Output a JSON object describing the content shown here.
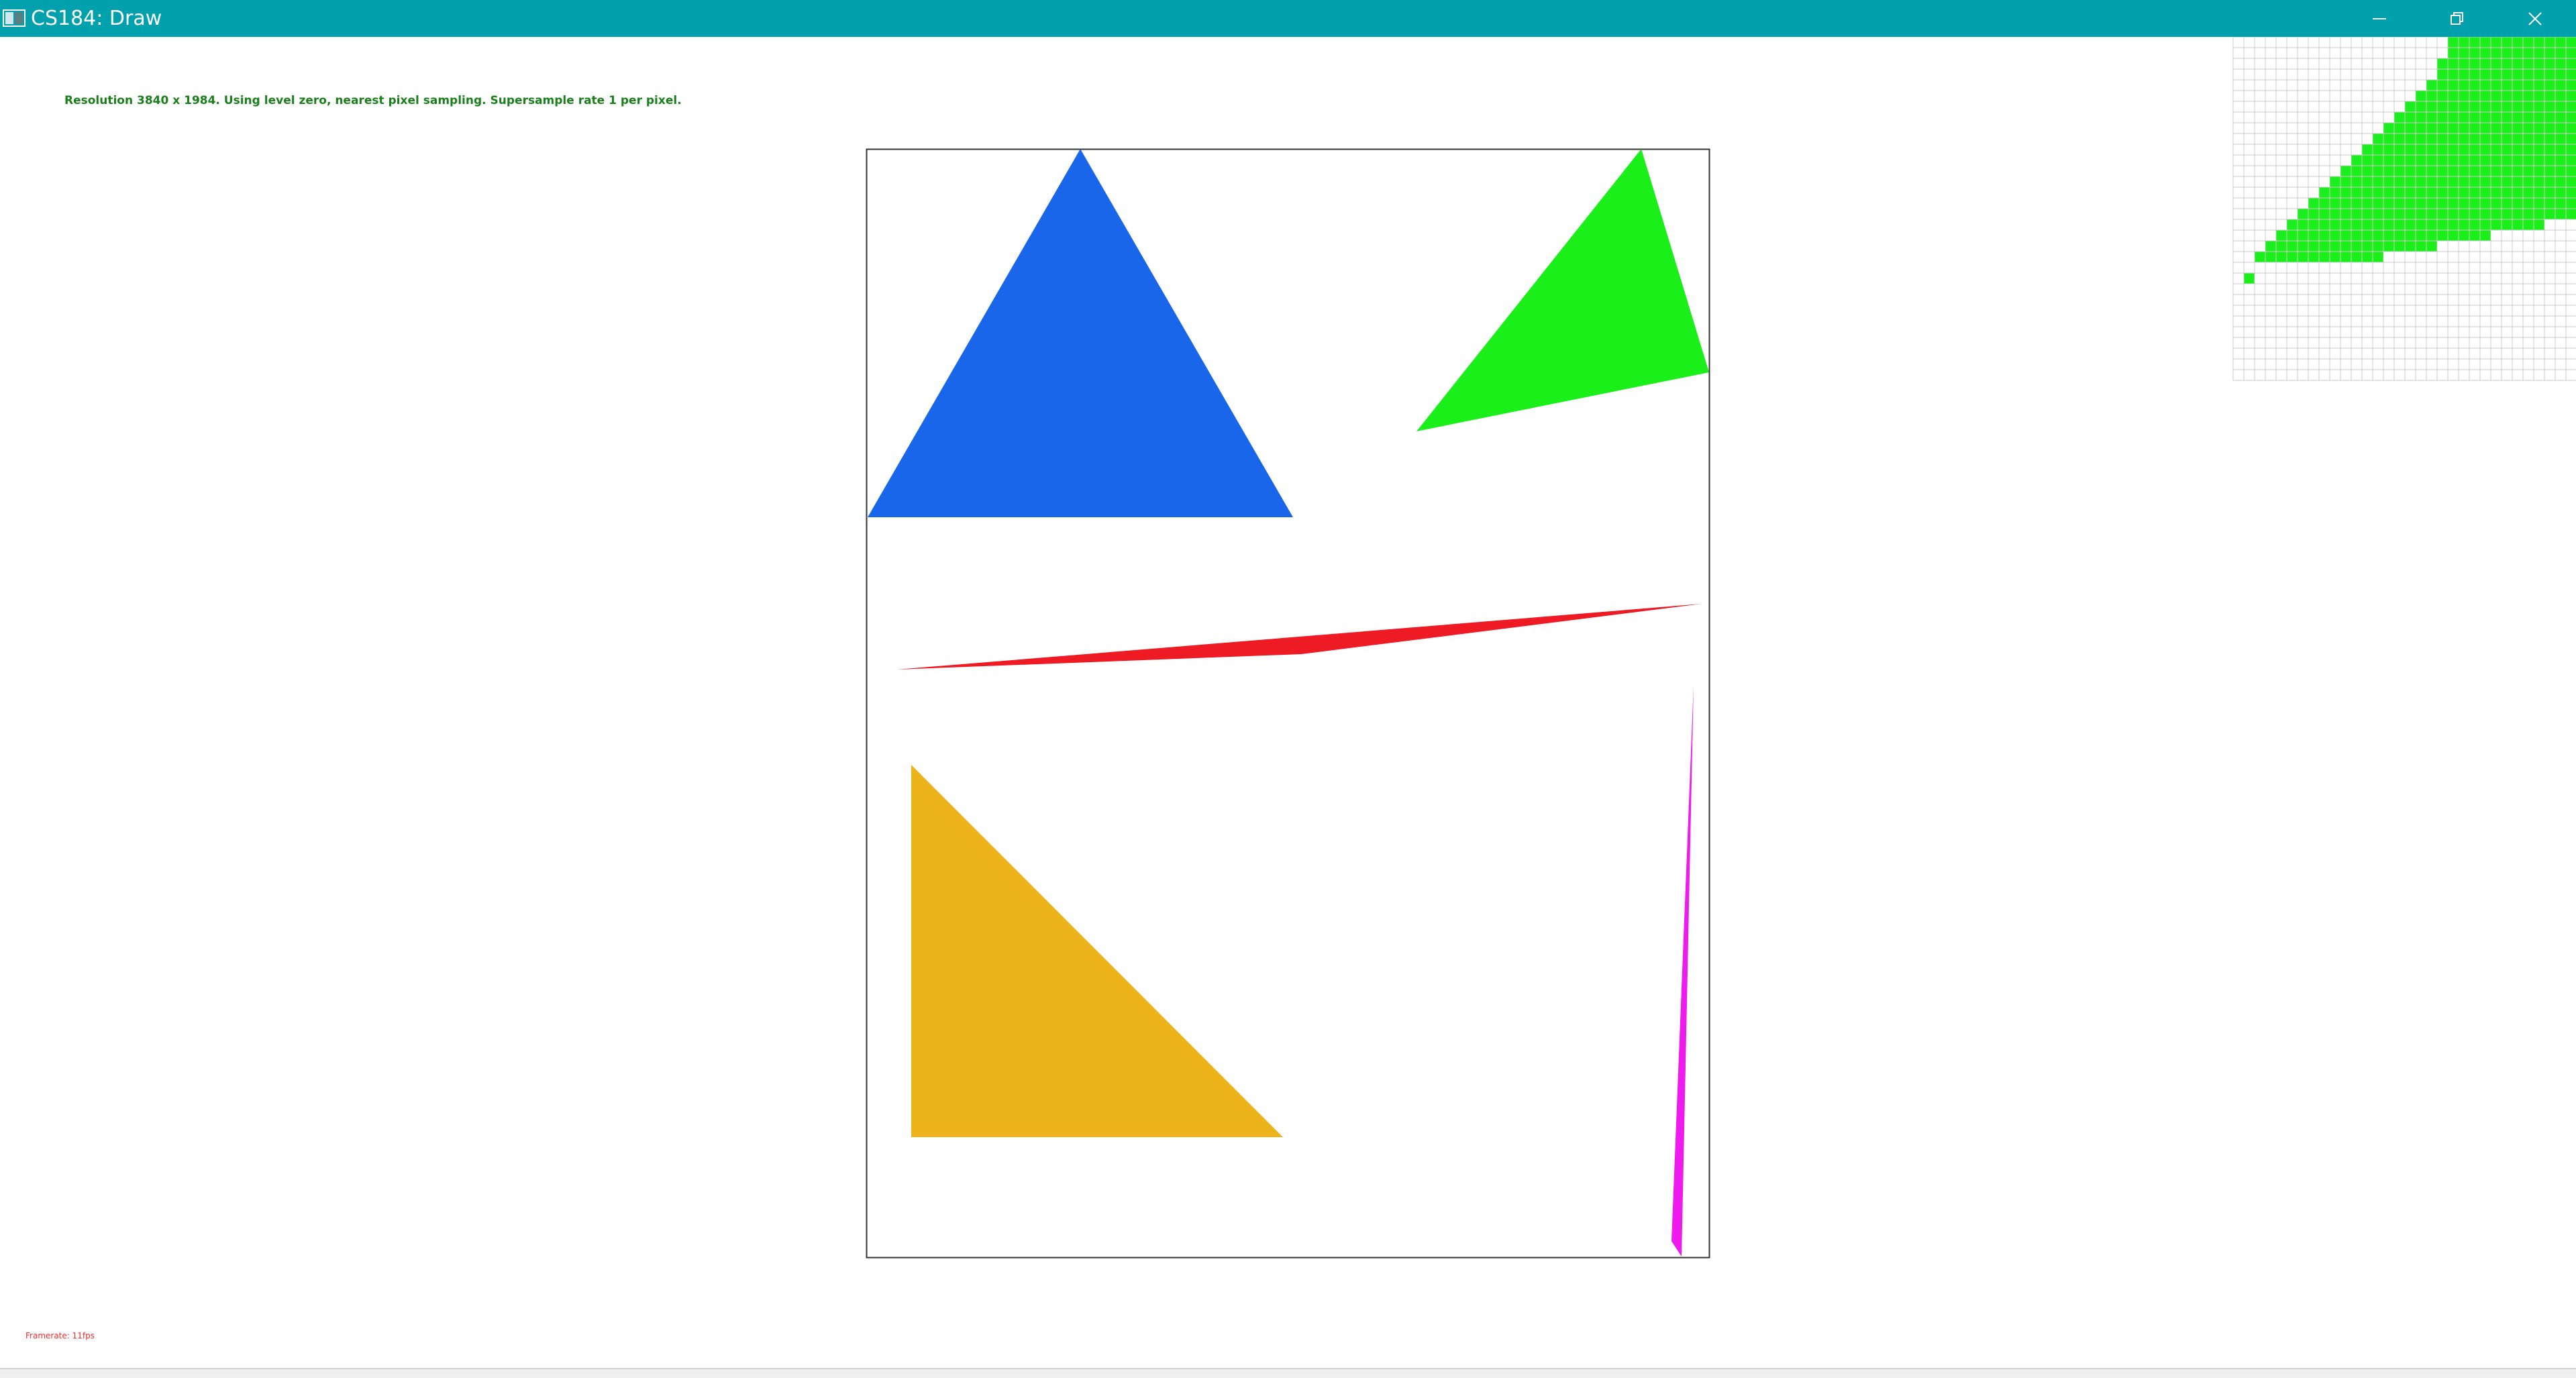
{
  "window": {
    "title": "CS184: Draw",
    "controls": {
      "minimize_icon": "minimize-icon",
      "restore_icon": "restore-icon",
      "close_icon": "close-icon"
    },
    "titlebar_color": "#01a0ad"
  },
  "overlay": {
    "status_text": "Resolution 3840 x 1984. Using level zero, nearest pixel sampling. Supersample rate 1 per pixel.",
    "status_color": "#1a7f1a",
    "framerate_text": "Framerate: 11fps",
    "framerate_color": "#ff2a2a"
  },
  "scene": {
    "shapes": [
      {
        "name": "blue-triangle",
        "color": "#1a66ea"
      },
      {
        "name": "green-triangle",
        "color": "#1aef1a"
      },
      {
        "name": "red-sliver-triangle",
        "color": "#ee1a24"
      },
      {
        "name": "orange-triangle",
        "color": "#ecb31a"
      },
      {
        "name": "magenta-sliver-triangle",
        "color": "#ee1aee"
      }
    ]
  },
  "zoom_inset": {
    "fill_color": "#1aef1a",
    "grid_color": "#c8c8c8"
  }
}
